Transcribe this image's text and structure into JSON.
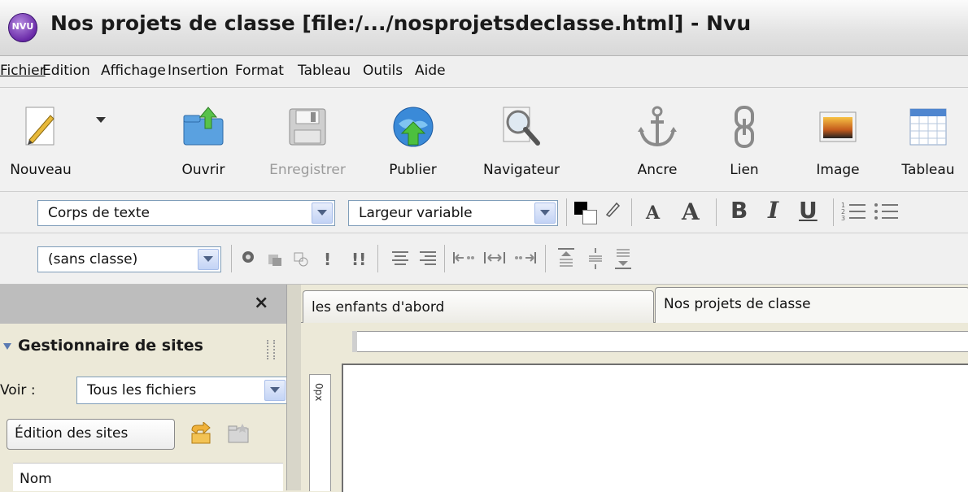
{
  "window": {
    "title": "Nos projets de classe [file:/.../nosprojetsdeclasse.html] - Nvu",
    "app_icon_text": "NVU"
  },
  "menu": [
    {
      "label": "Fichier",
      "mnemonic_index": 0
    },
    {
      "label": "Edition",
      "mnemonic_index": 0
    },
    {
      "label": "Affichage",
      "mnemonic_index": 0
    },
    {
      "label": "Insertion",
      "mnemonic_index": 0
    },
    {
      "label": "Format",
      "mnemonic_index": 1
    },
    {
      "label": "Tableau",
      "mnemonic_index": 2
    },
    {
      "label": "Outils",
      "mnemonic_index": 0
    },
    {
      "label": "Aide",
      "mnemonic_index": 0
    }
  ],
  "toolbar": {
    "new": "Nouveau",
    "open": "Ouvrir",
    "save": "Enregistrer",
    "publish": "Publier",
    "browse": "Navigateur",
    "anchor": "Ancre",
    "link": "Lien",
    "image": "Image",
    "table": "Tableau"
  },
  "format_bar": {
    "paragraph_format": "Corps de texte",
    "font": "Largeur variable",
    "text_color": "#000000",
    "bold": "B",
    "italic": "I",
    "underline": "U",
    "smaller_font": "A",
    "larger_font": "A"
  },
  "format_bar2": {
    "class_select": "(sans classe)",
    "exclamation": "!",
    "double_exclamation": "!!"
  },
  "left_panel": {
    "close": "×",
    "title": "Gestionnaire de sites",
    "view_label": "Voir :",
    "view_value": "Tous les fichiers",
    "edit_sites_button": "Édition des sites",
    "list_header": "Nom"
  },
  "tabs": [
    {
      "label": "les enfants d'abord",
      "active": false
    },
    {
      "label": "Nos projets de classe",
      "active": true
    }
  ],
  "editor": {
    "ruler_unit": "0px"
  },
  "colors": {
    "title_bar": "#e2e2e2",
    "panel_header": "#bdbdbd",
    "window_bg": "#ece9d8"
  }
}
